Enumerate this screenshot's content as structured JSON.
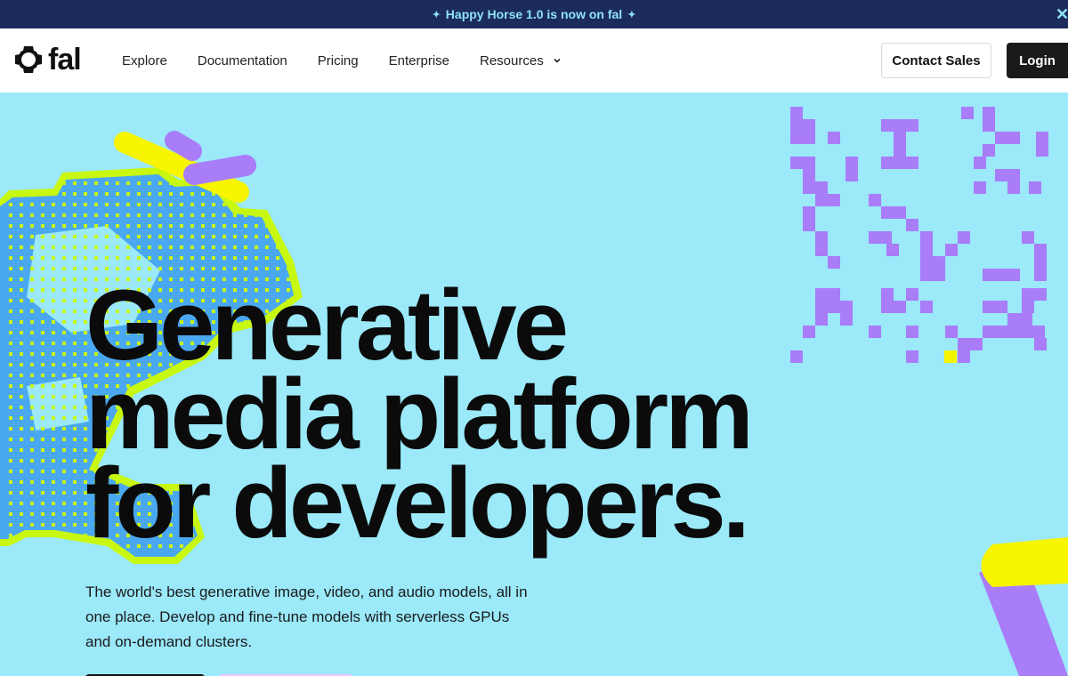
{
  "banner": {
    "text": "Happy Horse 1.0 is now on fal",
    "close_icon": "close-icon"
  },
  "nav": {
    "logo_text": "fal",
    "items": [
      {
        "label": "Explore"
      },
      {
        "label": "Documentation"
      },
      {
        "label": "Pricing"
      },
      {
        "label": "Enterprise"
      },
      {
        "label": "Resources",
        "has_dropdown": true
      }
    ],
    "contact_label": "Contact Sales",
    "login_label": "Login"
  },
  "hero": {
    "headline": [
      "Generative",
      "media platform",
      "for developers."
    ],
    "subtext": "The world's best generative image, video, and audio models, all in one place. Develop and fine-tune models with serverless GPUs and on-demand clusters."
  },
  "colors": {
    "banner_bg": "#1b2b5c",
    "banner_text": "#8ee3f5",
    "hero_bg": "#9be9f9",
    "accent_purple": "#a97cf8",
    "accent_yellow": "#f7f500",
    "accent_lime": "#c8f711",
    "accent_blue": "#4aa8f0",
    "button_dark": "#1a1a1a"
  }
}
